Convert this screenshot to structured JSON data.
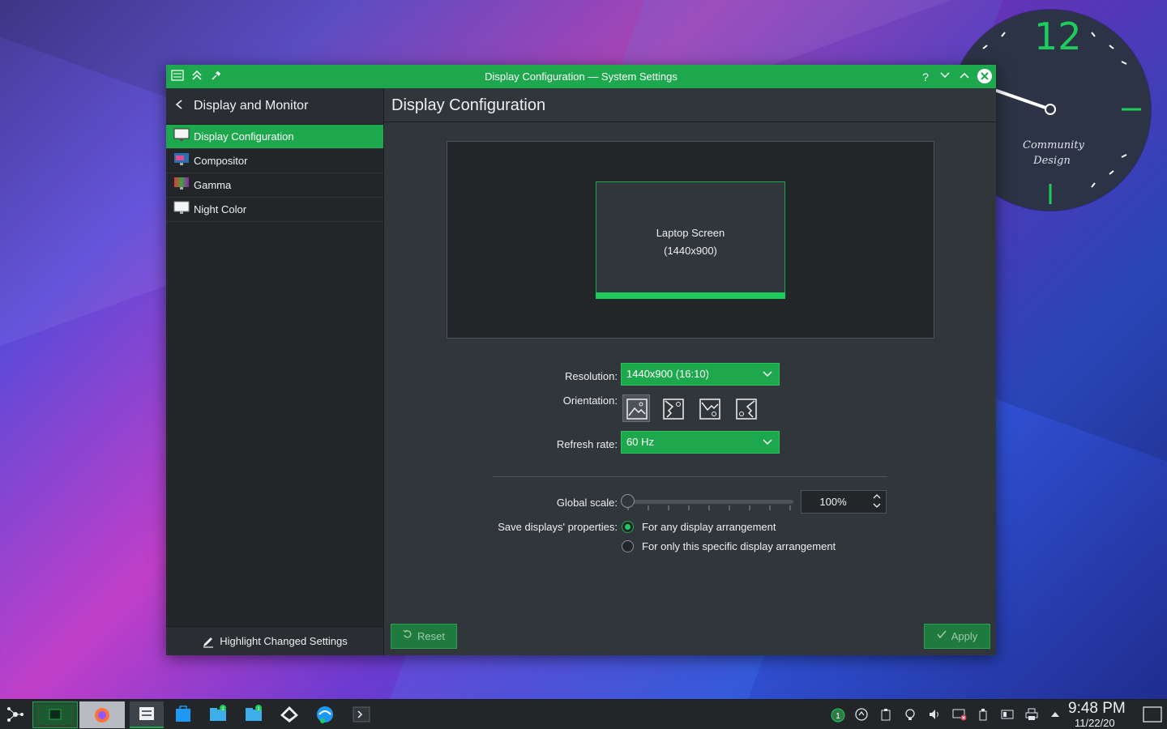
{
  "desktop": {
    "clock_widget": {
      "hour_label": "12",
      "brand_line1": "Community",
      "brand_line2": "Design"
    }
  },
  "window": {
    "title": "Display Configuration — System Settings",
    "accent_color": "#1ea84d",
    "titlebar_buttons": {
      "help": "?"
    }
  },
  "sidebar": {
    "header": "Display and Monitor",
    "items": [
      {
        "label": "Display Configuration",
        "active": true
      },
      {
        "label": "Compositor",
        "active": false
      },
      {
        "label": "Gamma",
        "active": false
      },
      {
        "label": "Night Color",
        "active": false
      }
    ],
    "footer_label": "Highlight Changed Settings"
  },
  "main": {
    "title": "Display Configuration",
    "screen": {
      "name": "Laptop Screen",
      "mode": "(1440x900)"
    },
    "resolution": {
      "label": "Resolution:",
      "value": "1440x900 (16:10)"
    },
    "orientation": {
      "label": "Orientation:",
      "selected": "landscape"
    },
    "refresh_rate": {
      "label": "Refresh rate:",
      "value": "60 Hz"
    },
    "global_scale": {
      "label": "Global scale:",
      "value": "100%",
      "slider_fraction": 0.0
    },
    "save_properties": {
      "label": "Save displays' properties:",
      "options": [
        {
          "label": "For any display arrangement",
          "checked": true
        },
        {
          "label": "For only this specific display arrangement",
          "checked": false
        }
      ]
    },
    "buttons": {
      "reset": "Reset",
      "apply": "Apply"
    }
  },
  "taskbar": {
    "time": "9:48 PM",
    "date": "11/22/20",
    "badges": {
      "files_1": "1",
      "files_2": "1",
      "updates": "1"
    }
  }
}
